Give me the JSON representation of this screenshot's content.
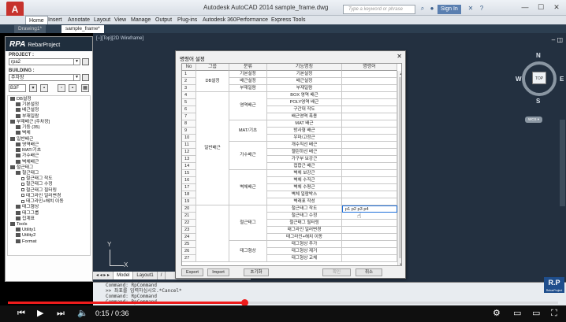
{
  "titlebar": {
    "app_logo": "A",
    "title": "Autodesk AutoCAD 2014    sample_frame.dwg",
    "search_placeholder": "Type a keyword or phrase",
    "signin": "Sign In",
    "minimize": "—",
    "maximize": "☐",
    "close": "✕"
  },
  "ribbon": {
    "tabs": [
      "Home",
      "Insert",
      "Annotate",
      "Layout",
      "View",
      "Manage",
      "Output",
      "Plug-ins",
      "Autodesk 360",
      "Performance",
      "Express Tools"
    ]
  },
  "doctabs": [
    "Drawing1*",
    "sample_frame*"
  ],
  "panel": {
    "title": "RPA",
    "subtitle": "RebarProject",
    "project_label": "PROJECT :",
    "project_value": "rpa2",
    "building_label": "BUILDING :",
    "building_value": "주차장",
    "toolbar_select": "B3F",
    "tree": [
      {
        "indent": 0,
        "type": "fold",
        "text": "DB설정"
      },
      {
        "indent": 1,
        "type": "fold",
        "text": "기본설정"
      },
      {
        "indent": 1,
        "type": "fold",
        "text": "배근설정"
      },
      {
        "indent": 1,
        "type": "fold",
        "text": "부재일람"
      },
      {
        "indent": 0,
        "type": "fold",
        "text": "부재배근     [주차장]"
      },
      {
        "indent": 1,
        "type": "fold",
        "text": "기둥 (35)"
      },
      {
        "indent": 1,
        "type": "fold",
        "text": "벽체"
      },
      {
        "indent": 0,
        "type": "fold",
        "text": "일반배근"
      },
      {
        "indent": 1,
        "type": "fold",
        "text": "영역배근"
      },
      {
        "indent": 1,
        "type": "fold",
        "text": "MAT/기초"
      },
      {
        "indent": 1,
        "type": "fold",
        "text": "가수배근"
      },
      {
        "indent": 1,
        "type": "fold",
        "text": "벽체배근"
      },
      {
        "indent": 0,
        "type": "fold",
        "text": "철근태그"
      },
      {
        "indent": 1,
        "type": "fold",
        "text": "철근태그"
      },
      {
        "indent": 2,
        "type": "leaf",
        "text": "철근태그 작도"
      },
      {
        "indent": 2,
        "type": "leaf",
        "text": "철근태그 수정"
      },
      {
        "indent": 2,
        "type": "leaf",
        "text": "철근태그 필터링"
      },
      {
        "indent": 2,
        "type": "leaf",
        "text": "태그라인 일러변경"
      },
      {
        "indent": 2,
        "type": "leaf",
        "text": "태그라인+해치 이동"
      },
      {
        "indent": 1,
        "type": "fold",
        "text": "태그형상"
      },
      {
        "indent": 1,
        "type": "fold",
        "text": "태그그룹"
      },
      {
        "indent": 1,
        "type": "fold",
        "text": "집계표"
      },
      {
        "indent": 0,
        "type": "fold",
        "text": "Tools"
      },
      {
        "indent": 1,
        "type": "fold",
        "text": "Utility1"
      },
      {
        "indent": 1,
        "type": "fold",
        "text": "Utility2"
      },
      {
        "indent": 1,
        "type": "fold",
        "text": "Format"
      }
    ]
  },
  "viewport": {
    "label": "[−][Top][2D Wireframe]",
    "compass": {
      "n": "N",
      "s": "S",
      "e": "E",
      "w": "W",
      "top": "TOP",
      "wcs": "WCS ▾"
    },
    "ucs_x": "X",
    "ucs_y": "Y",
    "model_tabs": [
      "Model",
      "Layout1",
      "/"
    ]
  },
  "dialog": {
    "title": "명령어 설정",
    "close": "✕",
    "columns": [
      "No",
      "그룹",
      "분류",
      "기능명칭",
      "명령어"
    ],
    "rows": [
      {
        "no": "1",
        "func": "기본설정",
        "cmd": ""
      },
      {
        "no": "2",
        "func": "배근설정",
        "cmd": ""
      },
      {
        "no": "3",
        "func": "부재일람",
        "cmd": ""
      },
      {
        "no": "4",
        "func": "BOX 영역 배근",
        "cmd": ""
      },
      {
        "no": "5",
        "func": "POLY영역 배근",
        "cmd": ""
      },
      {
        "no": "6",
        "func": "구간대 작도",
        "cmd": ""
      },
      {
        "no": "7",
        "func": "배근영역 폭용",
        "cmd": ""
      },
      {
        "no": "8",
        "func": "MAT 배근",
        "cmd": ""
      },
      {
        "no": "9",
        "func": "방사형 배근",
        "cmd": ""
      },
      {
        "no": "10",
        "func": "우마/고정근",
        "cmd": ""
      },
      {
        "no": "11",
        "func": "개수직선 배근",
        "cmd": ""
      },
      {
        "no": "12",
        "func": "챌린하선 배근",
        "cmd": ""
      },
      {
        "no": "13",
        "func": "가구부 보강근",
        "cmd": ""
      },
      {
        "no": "14",
        "func": "접합근 배근",
        "cmd": ""
      },
      {
        "no": "15",
        "func": "벽체 보강근",
        "cmd": ""
      },
      {
        "no": "16",
        "func": "벽체 수직근",
        "cmd": ""
      },
      {
        "no": "17",
        "func": "벽체 수평근",
        "cmd": ""
      },
      {
        "no": "18",
        "func": "벽체 일람박스",
        "cmd": ""
      },
      {
        "no": "19",
        "func": "벽래표 작성",
        "cmd": ""
      },
      {
        "no": "20",
        "func": "철근태그 작도",
        "cmd": "p1 p2 p3 p4"
      },
      {
        "no": "21",
        "func": "철근태그 수정",
        "cmd": ""
      },
      {
        "no": "22",
        "func": "철근태그 필터링",
        "cmd": ""
      },
      {
        "no": "23",
        "func": "태그라인 일러변경",
        "cmd": ""
      },
      {
        "no": "24",
        "func": "태그라인+해치 이동",
        "cmd": ""
      },
      {
        "no": "25",
        "func": "태그형상 추가",
        "cmd": ""
      },
      {
        "no": "26",
        "func": "태그형상 제거",
        "cmd": ""
      },
      {
        "no": "27",
        "func": "태그형상 교체",
        "cmd": ""
      }
    ],
    "groups": [
      {
        "text": "DB설정",
        "start": 0,
        "span": 3
      },
      {
        "text": "일반배근",
        "start": 3,
        "span": 16
      },
      {
        "text": "",
        "start": 19,
        "span": 8
      }
    ],
    "categories": [
      {
        "text": "기본설정",
        "start": 0,
        "span": 1
      },
      {
        "text": "배근설정",
        "start": 1,
        "span": 1
      },
      {
        "text": "부재일람",
        "start": 2,
        "span": 1
      },
      {
        "text": "영역배근",
        "start": 3,
        "span": 4
      },
      {
        "text": "MAT/기초",
        "start": 7,
        "span": 3
      },
      {
        "text": "가수배근",
        "start": 10,
        "span": 4
      },
      {
        "text": "벽체배근",
        "start": 14,
        "span": 5
      },
      {
        "text": "철근태그",
        "start": 19,
        "span": 5
      },
      {
        "text": "태그형상",
        "start": 24,
        "span": 3
      }
    ],
    "buttons": {
      "export": "Export",
      "import": "Import",
      "reset": "초기화",
      "ok": "확인",
      "cancel": "취소"
    }
  },
  "command": {
    "lines": [
      "Command: RpCommand",
      ">> 좌표를 입력하십시오.*Cancel*",
      "Command: RpCommand",
      "Command: RpCommand"
    ]
  },
  "rp_logo": {
    "text": "R.P",
    "sub": "RebarProject"
  },
  "player": {
    "time": "0:15 / 0:36",
    "progress": 0.43,
    "colors": {
      "accent": "#ee1c1c"
    }
  }
}
